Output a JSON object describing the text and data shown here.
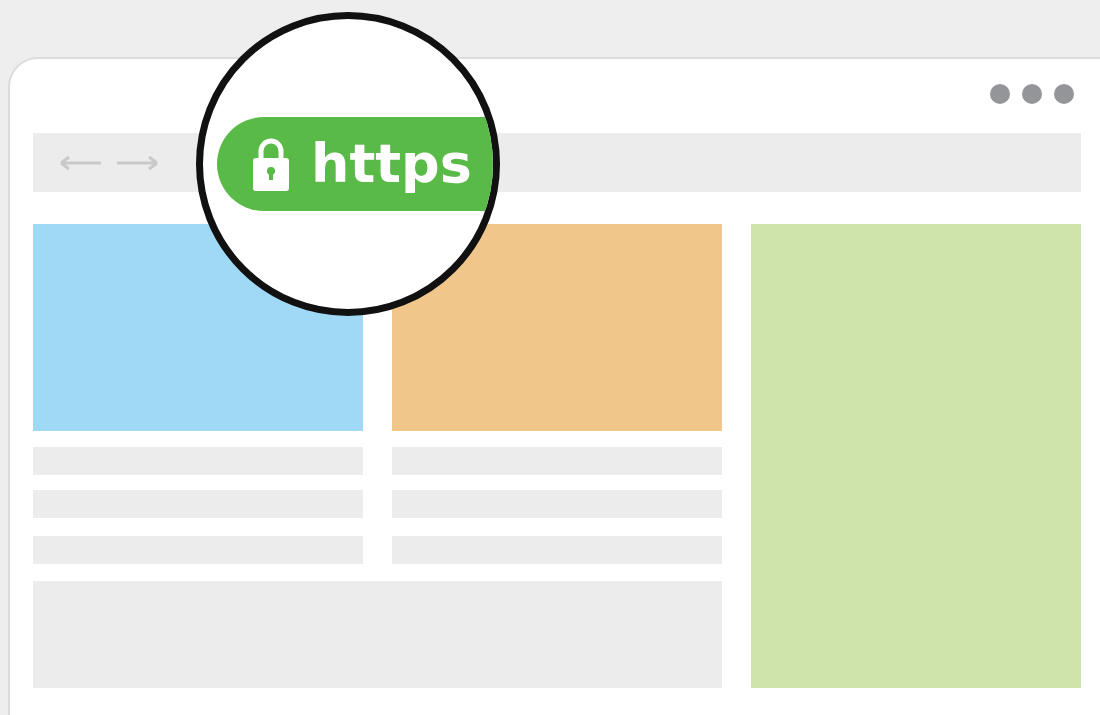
{
  "magnifier": {
    "badge": {
      "text": "https"
    }
  }
}
